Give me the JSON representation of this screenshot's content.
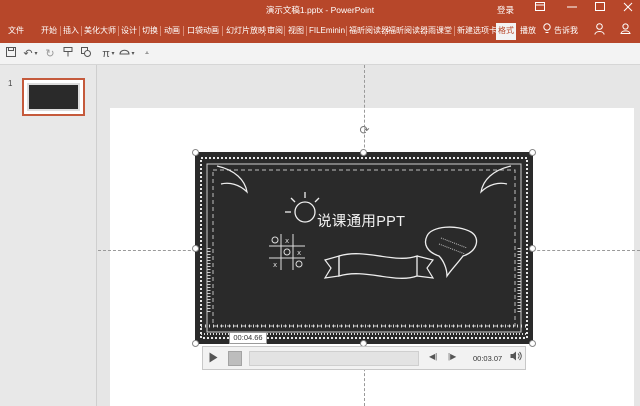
{
  "window": {
    "title": "演示文稿1.pptx  -  PowerPoint",
    "login_label": "登录"
  },
  "ribbon": {
    "tabs": [
      {
        "label": "文件"
      },
      {
        "label": "开始"
      },
      {
        "label": "插入"
      },
      {
        "label": "美化大师"
      },
      {
        "label": "设计"
      },
      {
        "label": "切换"
      },
      {
        "label": "动画"
      },
      {
        "label": "口袋动画"
      },
      {
        "label": "幻灯片放映"
      },
      {
        "label": "审阅"
      },
      {
        "label": "视图"
      },
      {
        "label": "FILEminin"
      },
      {
        "label": "福昕阅读器"
      },
      {
        "label": "福昕阅读器"
      },
      {
        "label": "雨课堂"
      },
      {
        "label": "新建选项卡"
      },
      {
        "label": "格式"
      },
      {
        "label": "播放"
      }
    ],
    "tell_me": "告诉我"
  },
  "slides_pane": {
    "slide_number": "1"
  },
  "slide": {
    "video_title": "说课通用PPT"
  },
  "media_controls": {
    "tooltip_time": "00:04.66",
    "current_time": "00:03.07"
  },
  "colors": {
    "accent": "#b7472a",
    "thumb_border": "#c55a3c",
    "board": "#222222"
  }
}
